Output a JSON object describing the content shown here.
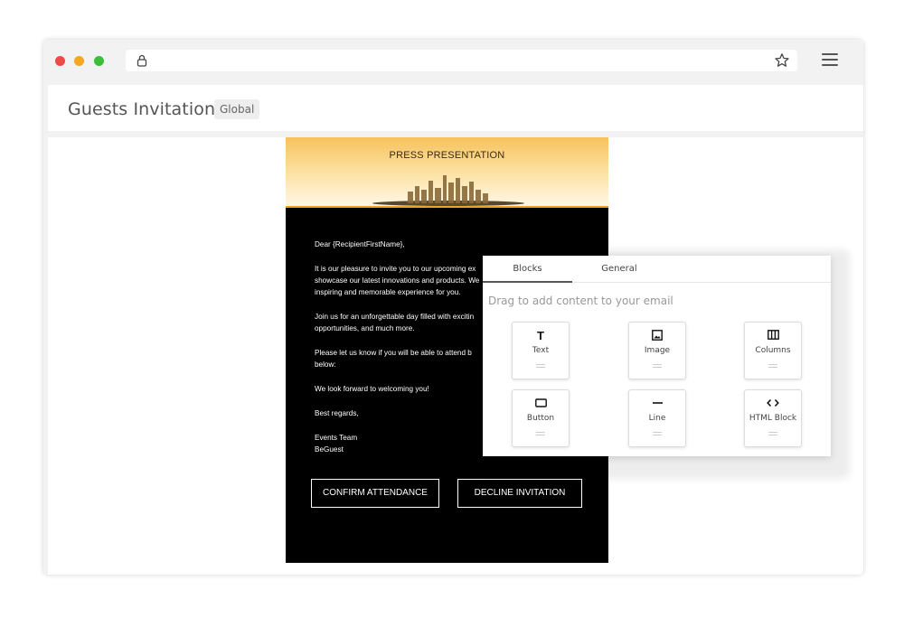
{
  "header": {
    "title": "Guests Invitation",
    "badge": "Global"
  },
  "email": {
    "hero_title": "PRESS PRESENTATION",
    "paragraphs": {
      "greeting": "Dear {RecipientFirstName},",
      "p1_l1": "It is our pleasure to invite you to our upcoming ex",
      "p1_l2": "showcase our latest innovations and products. We",
      "p1_l3": "inspiring and memorable experience for you.",
      "p2_l1": "Join us for an unforgettable day filled with excitin",
      "p2_l2": "opportunities, and much more.",
      "p3_l1": "Please let us know if you will be able to attend b",
      "p3_l2": "below:",
      "p4": "We look forward to welcoming you!",
      "p5": "Best regards,",
      "sig1": "Events Team",
      "sig2": "BeGuest"
    },
    "confirm_label": "CONFIRM ATTENDANCE",
    "decline_label": "DECLINE INVITATION"
  },
  "panel": {
    "tabs": {
      "blocks": "Blocks",
      "general": "General"
    },
    "hint": "Drag to add content to your email",
    "blocks": [
      {
        "label": "Text",
        "icon": "text-icon"
      },
      {
        "label": "Image",
        "icon": "image-icon"
      },
      {
        "label": "Columns",
        "icon": "columns-icon"
      },
      {
        "label": "Button",
        "icon": "button-icon"
      },
      {
        "label": "Line",
        "icon": "line-icon"
      },
      {
        "label": "HTML Block",
        "icon": "code-icon"
      }
    ]
  }
}
